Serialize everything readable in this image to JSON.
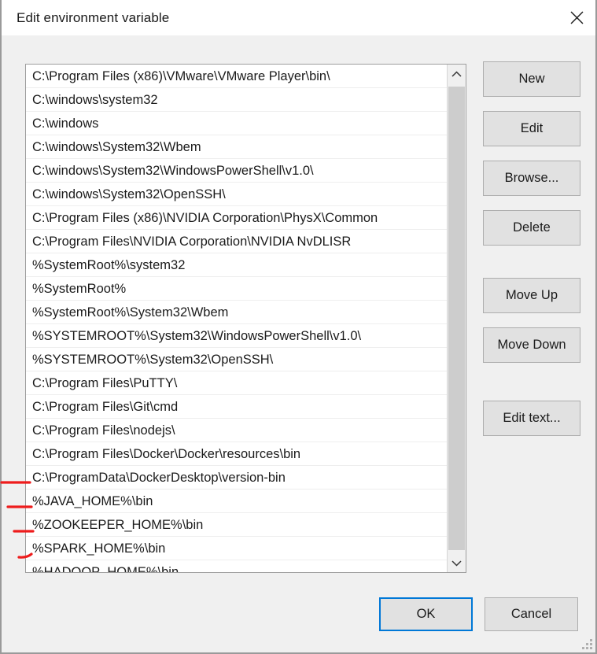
{
  "window": {
    "title": "Edit environment variable",
    "close_icon": "close-icon"
  },
  "list": {
    "items": [
      "C:\\Program Files (x86)\\VMware\\VMware Player\\bin\\",
      "C:\\windows\\system32",
      "C:\\windows",
      "C:\\windows\\System32\\Wbem",
      "C:\\windows\\System32\\WindowsPowerShell\\v1.0\\",
      "C:\\windows\\System32\\OpenSSH\\",
      "C:\\Program Files (x86)\\NVIDIA Corporation\\PhysX\\Common",
      "C:\\Program Files\\NVIDIA Corporation\\NVIDIA NvDLISR",
      "%SystemRoot%\\system32",
      "%SystemRoot%",
      "%SystemRoot%\\System32\\Wbem",
      "%SYSTEMROOT%\\System32\\WindowsPowerShell\\v1.0\\",
      "%SYSTEMROOT%\\System32\\OpenSSH\\",
      "C:\\Program Files\\PuTTY\\",
      "C:\\Program Files\\Git\\cmd",
      "C:\\Program Files\\nodejs\\",
      "C:\\Program Files\\Docker\\Docker\\resources\\bin",
      "C:\\ProgramData\\DockerDesktop\\version-bin",
      "%JAVA_HOME%\\bin",
      "%ZOOKEEPER_HOME%\\bin",
      "%SPARK_HOME%\\bin",
      "%HADOOP_HOME%\\bin"
    ],
    "annotated_indices": [
      18,
      19,
      20,
      21
    ],
    "scrollbar": {
      "up_arrow_icon": "chevron-up-icon",
      "down_arrow_icon": "chevron-down-icon"
    }
  },
  "side_buttons": [
    {
      "label": "New",
      "name": "new-button"
    },
    {
      "label": "Edit",
      "name": "edit-button"
    },
    {
      "label": "Browse...",
      "name": "browse-button"
    },
    {
      "label": "Delete",
      "name": "delete-button"
    },
    {
      "label": "Move Up",
      "name": "move-up-button"
    },
    {
      "label": "Move Down",
      "name": "move-down-button"
    },
    {
      "label": "Edit text...",
      "name": "edit-text-button"
    }
  ],
  "bottom_buttons": {
    "ok": "OK",
    "cancel": "Cancel"
  },
  "colors": {
    "dialog_background": "#f0f0f0",
    "titlebar_background": "#ffffff",
    "button_face": "#e1e1e1",
    "button_border": "#adadad",
    "focus_accent": "#0078d7",
    "scrollbar_thumb": "#cdcdcd",
    "annotation_red": "#ee1c1c",
    "text": "#1b1b1b"
  }
}
